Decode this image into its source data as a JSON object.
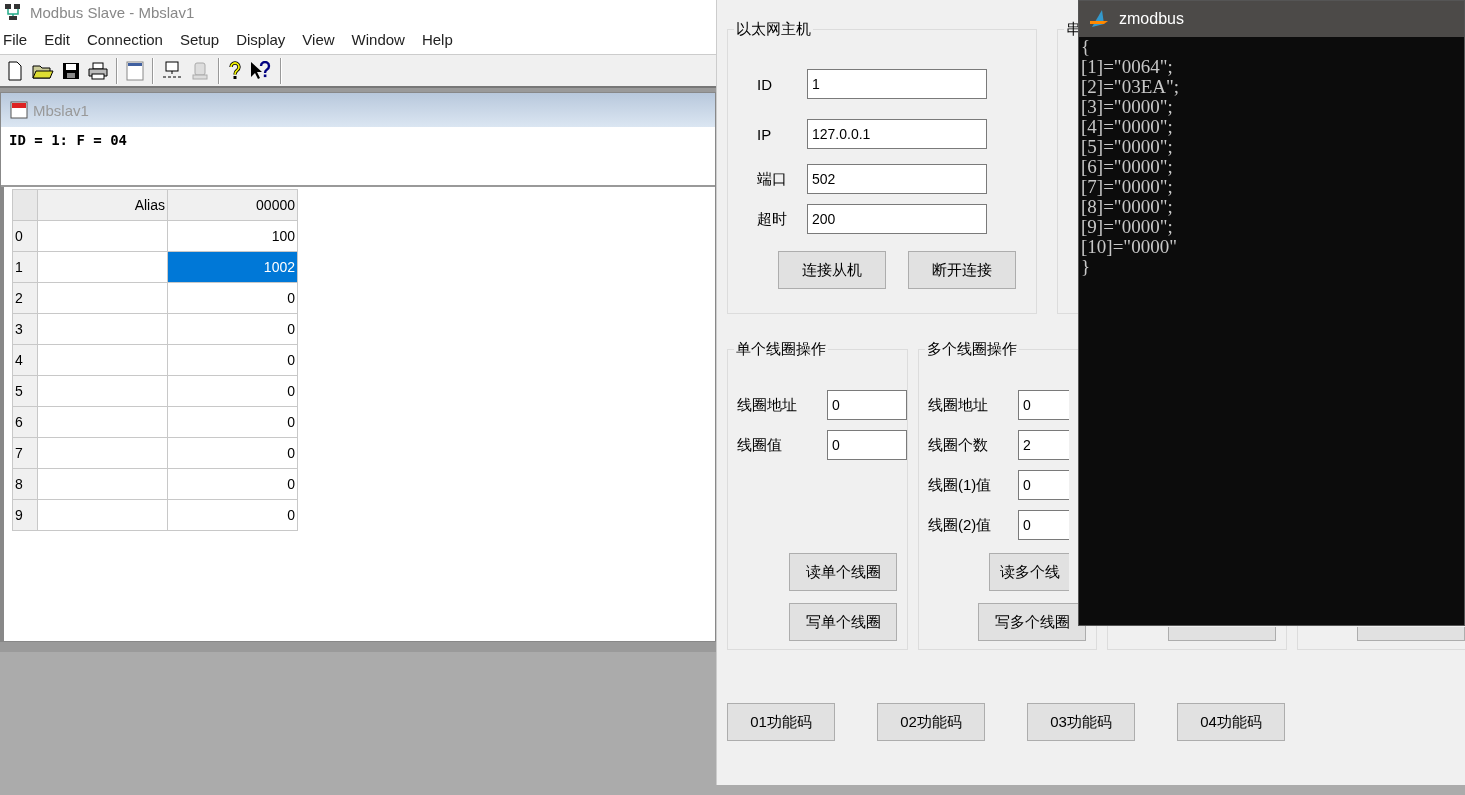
{
  "slave_window": {
    "title": "Modbus Slave - Mbslav1",
    "menu": [
      "File",
      "Edit",
      "Connection",
      "Setup",
      "Display",
      "View",
      "Window",
      "Help"
    ],
    "child": {
      "title": "Mbslav1",
      "header": "ID = 1: F = 04",
      "columns": [
        "Alias",
        "00000"
      ],
      "rows": [
        {
          "index": "0",
          "value": "100",
          "selected": false
        },
        {
          "index": "1",
          "value": "1002",
          "selected": true
        },
        {
          "index": "2",
          "value": "0",
          "selected": false
        },
        {
          "index": "3",
          "value": "0",
          "selected": false
        },
        {
          "index": "4",
          "value": "0",
          "selected": false
        },
        {
          "index": "5",
          "value": "0",
          "selected": false
        },
        {
          "index": "6",
          "value": "0",
          "selected": false
        },
        {
          "index": "7",
          "value": "0",
          "selected": false
        },
        {
          "index": "8",
          "value": "0",
          "selected": false
        },
        {
          "index": "9",
          "value": "0",
          "selected": false
        }
      ]
    }
  },
  "client_window": {
    "ethernet": {
      "legend": "以太网主机",
      "fields": [
        {
          "label": "ID",
          "value": "1"
        },
        {
          "label": "IP",
          "value": "127.0.0.1"
        },
        {
          "label": "端口",
          "value": "502"
        },
        {
          "label": "超时",
          "value": "200"
        }
      ],
      "buttons": [
        "连接从机",
        "断开连接"
      ]
    },
    "serial": {
      "legend": "串"
    },
    "single_coil": {
      "legend": "单个线圈操作",
      "fields": [
        {
          "label": "线圈地址",
          "value": "0"
        },
        {
          "label": "线圈值",
          "value": "0"
        }
      ],
      "buttons": [
        "读单个线圈",
        "写单个线圈"
      ]
    },
    "multi_coil": {
      "legend": "多个线圈操作",
      "fields": [
        {
          "label": "线圈地址",
          "value": "0"
        },
        {
          "label": "线圈个数",
          "value": "2"
        },
        {
          "label": "线圈(1)值",
          "value": "0"
        },
        {
          "label": "线圈(2)值",
          "value": "0"
        }
      ],
      "buttons": [
        "读多个线",
        "写多个线圈"
      ]
    },
    "function_buttons": [
      "01功能码",
      "02功能码",
      "03功能码",
      "04功能码"
    ]
  },
  "console": {
    "title": "zmodbus",
    "lines": [
      "{",
      "[1]=\"0064\";",
      "[2]=\"03EA\";",
      "[3]=\"0000\";",
      "[4]=\"0000\";",
      "[5]=\"0000\";",
      "[6]=\"0000\";",
      "[7]=\"0000\";",
      "[8]=\"0000\";",
      "[9]=\"0000\";",
      "[10]=\"0000\"",
      "}"
    ]
  }
}
